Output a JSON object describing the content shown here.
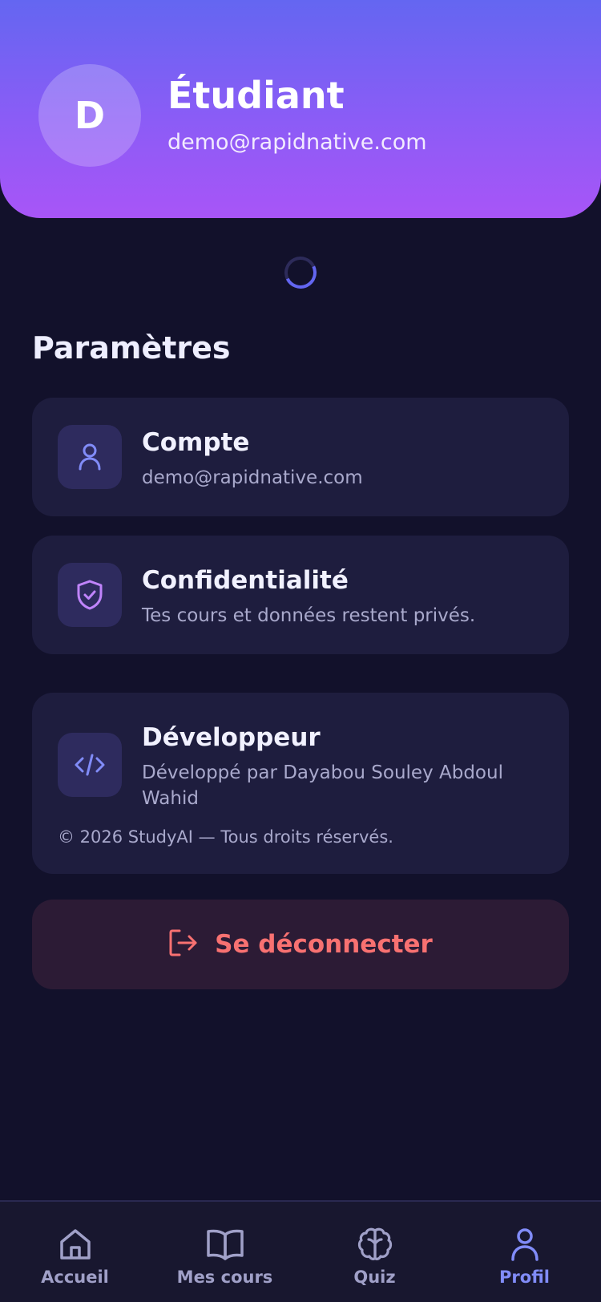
{
  "header": {
    "avatar_letter": "D",
    "name": "Étudiant",
    "email": "demo@rapidnative.com"
  },
  "settings": {
    "title": "Paramètres",
    "account": {
      "title": "Compte",
      "subtitle": "demo@rapidnative.com",
      "icon": "user-icon"
    },
    "privacy": {
      "title": "Confidentialité",
      "subtitle": "Tes cours et données restent privés.",
      "icon": "shield-check-icon"
    },
    "developer": {
      "title": "Développeur",
      "subtitle": "Développé par Dayabou Souley Abdoul Wahid",
      "copyright": "© 2026 StudyAI — Tous droits réservés.",
      "icon": "code-icon"
    },
    "logout_label": "Se déconnecter"
  },
  "nav": {
    "items": [
      {
        "label": "Accueil",
        "icon": "home-icon"
      },
      {
        "label": "Mes cours",
        "icon": "book-icon"
      },
      {
        "label": "Quiz",
        "icon": "brain-icon"
      },
      {
        "label": "Profil",
        "icon": "user-icon"
      }
    ],
    "active": "Profil"
  },
  "colors": {
    "background": "#12112b",
    "card": "#1e1d3e",
    "accent": "#818cf8",
    "danger": "#f87171",
    "header_gradient_start": "#6466f1",
    "header_gradient_end": "#a855f7"
  }
}
